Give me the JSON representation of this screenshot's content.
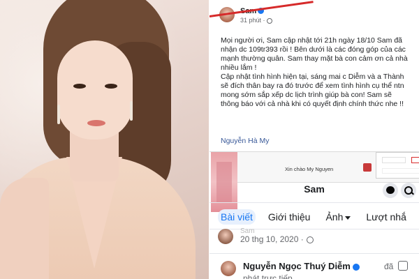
{
  "post": {
    "author": "Sam",
    "time": "31 phút ·",
    "paragraphs": [
      "Mọi người ơi, Sam cập nhật tới 21h ngày 18/10 Sam đã nhận dc 109tr393 rồi ! Bên dưới là các đóng góp của các mạnh thường quân. Sam thay mặt bà con cảm ơn cả nhà nhiều lắm !",
      "Cập nhật tình hình hiện tại, sáng mai c Diễm và a Thành sẽ đích thân bay ra đó trước để xem tình hình cụ thể ntn mong sớm sắp xếp dc lịch trình giúp bà con! Sam sẽ thông báo với cả nhà khi có quyết định chính thức nhe !!"
    ],
    "tag": "Nguyễn Hà My"
  },
  "profile": {
    "greeting": "Xin chào My Nguyen",
    "name": "Sam",
    "tabs": [
      {
        "label": "Bài viết",
        "active": true
      },
      {
        "label": "Giới thiệu",
        "active": false
      },
      {
        "label": "Ảnh",
        "active": false,
        "dropdown": true
      },
      {
        "label": "Lượt nhắ",
        "active": false
      }
    ],
    "row1_author": "Sam",
    "row1_date": "20 thg 10, 2020 ·",
    "row2_author": "Nguyễn Ngọc Thuý Diễm",
    "row2_suffix": "đã",
    "row2_line2": "phát trực tiếp"
  },
  "colors": {
    "facebook_blue": "#1877f2",
    "text_primary": "#1c1e21",
    "text_secondary": "#65676b",
    "highlight_red": "#d62a2a"
  }
}
